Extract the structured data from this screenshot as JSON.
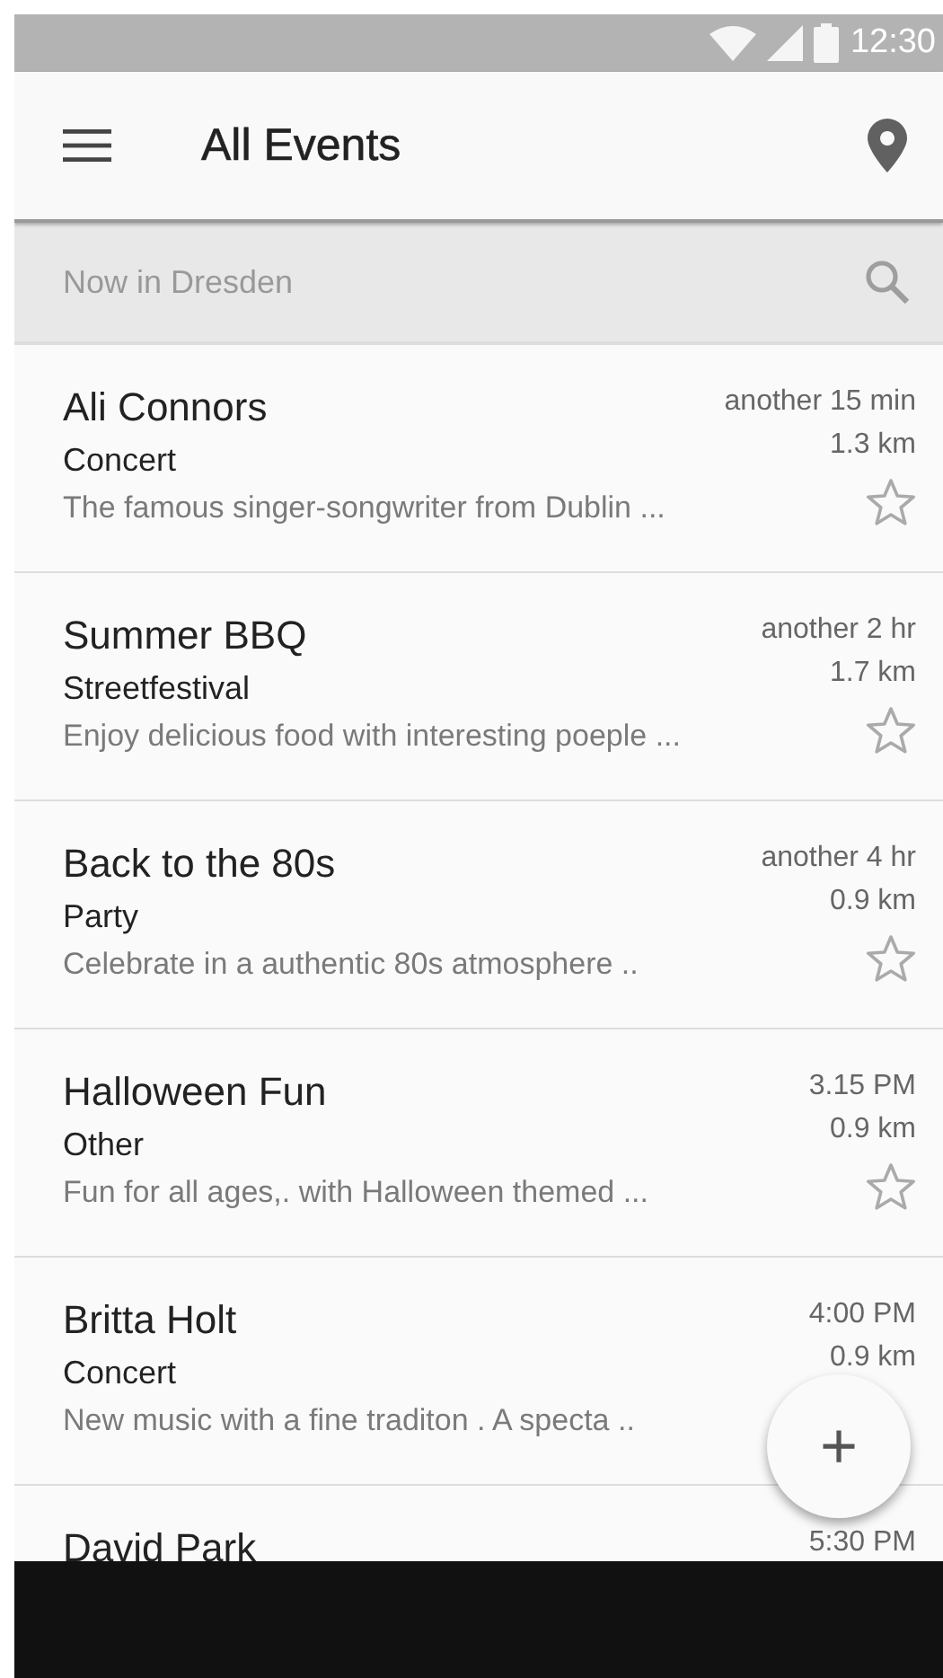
{
  "status_bar": {
    "time": "12:30"
  },
  "app_bar": {
    "title": "All Events"
  },
  "search": {
    "placeholder": "Now in Dresden"
  },
  "events": [
    {
      "title": "Ali Connors",
      "category": "Concert",
      "description": "The famous singer-songwriter from Dublin ...",
      "time": "another 15 min",
      "distance": "1.3 km",
      "starred": false
    },
    {
      "title": "Summer BBQ",
      "category": "Streetfestival",
      "description": "Enjoy delicious food with interesting poeple ...",
      "time": "another 2 hr",
      "distance": "1.7 km",
      "starred": false
    },
    {
      "title": "Back to the 80s",
      "category": "Party",
      "description": "Celebrate in a authentic 80s atmosphere ..",
      "time": "another 4 hr",
      "distance": "0.9 km",
      "starred": false
    },
    {
      "title": "Halloween Fun",
      "category": "Other",
      "description": "Fun for all ages,. with Halloween themed ...",
      "time": "3.15 PM",
      "distance": "0.9 km",
      "starred": false
    },
    {
      "title": "Britta Holt",
      "category": "Concert",
      "description": "New music with a fine traditon . A specta ..",
      "time": "4:00 PM",
      "distance": "0.9 km"
    },
    {
      "title": "David Park",
      "time": "5:30 PM"
    }
  ],
  "fab": {
    "label": "+"
  }
}
